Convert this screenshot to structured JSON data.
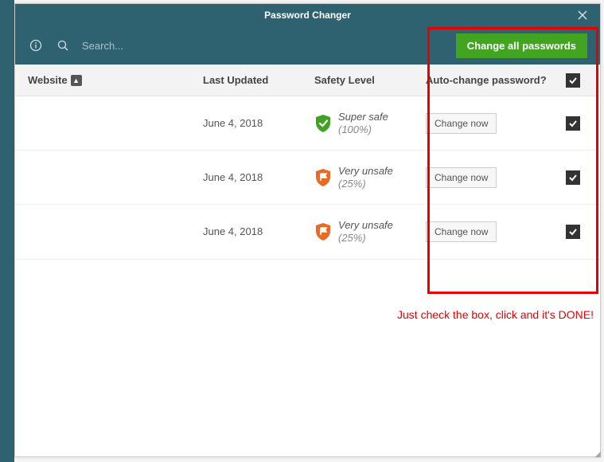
{
  "window": {
    "title": "Password Changer"
  },
  "toolbar": {
    "search_placeholder": "Search...",
    "change_all_label": "Change all passwords"
  },
  "columns": {
    "website": "Website",
    "last_updated": "Last Updated",
    "safety": "Safety Level",
    "auto": "Auto-change password?"
  },
  "rows": [
    {
      "website": "",
      "last_updated": "June 4, 2018",
      "safety_label": "Super safe",
      "safety_pct": "(100%)",
      "safety_color": "#3fa322",
      "safety_icon": "check",
      "change_label": "Change now",
      "checked": true
    },
    {
      "website": "",
      "last_updated": "June 4, 2018",
      "safety_label": "Very unsafe",
      "safety_pct": "(25%)",
      "safety_color": "#e86a25",
      "safety_icon": "flag",
      "change_label": "Change now",
      "checked": true
    },
    {
      "website": "",
      "last_updated": "June 4, 2018",
      "safety_label": "Very unsafe",
      "safety_pct": "(25%)",
      "safety_color": "#e86a25",
      "safety_icon": "flag",
      "change_label": "Change now",
      "checked": true
    }
  ],
  "annotation": {
    "text": "Just check the box, click and it's DONE!"
  }
}
